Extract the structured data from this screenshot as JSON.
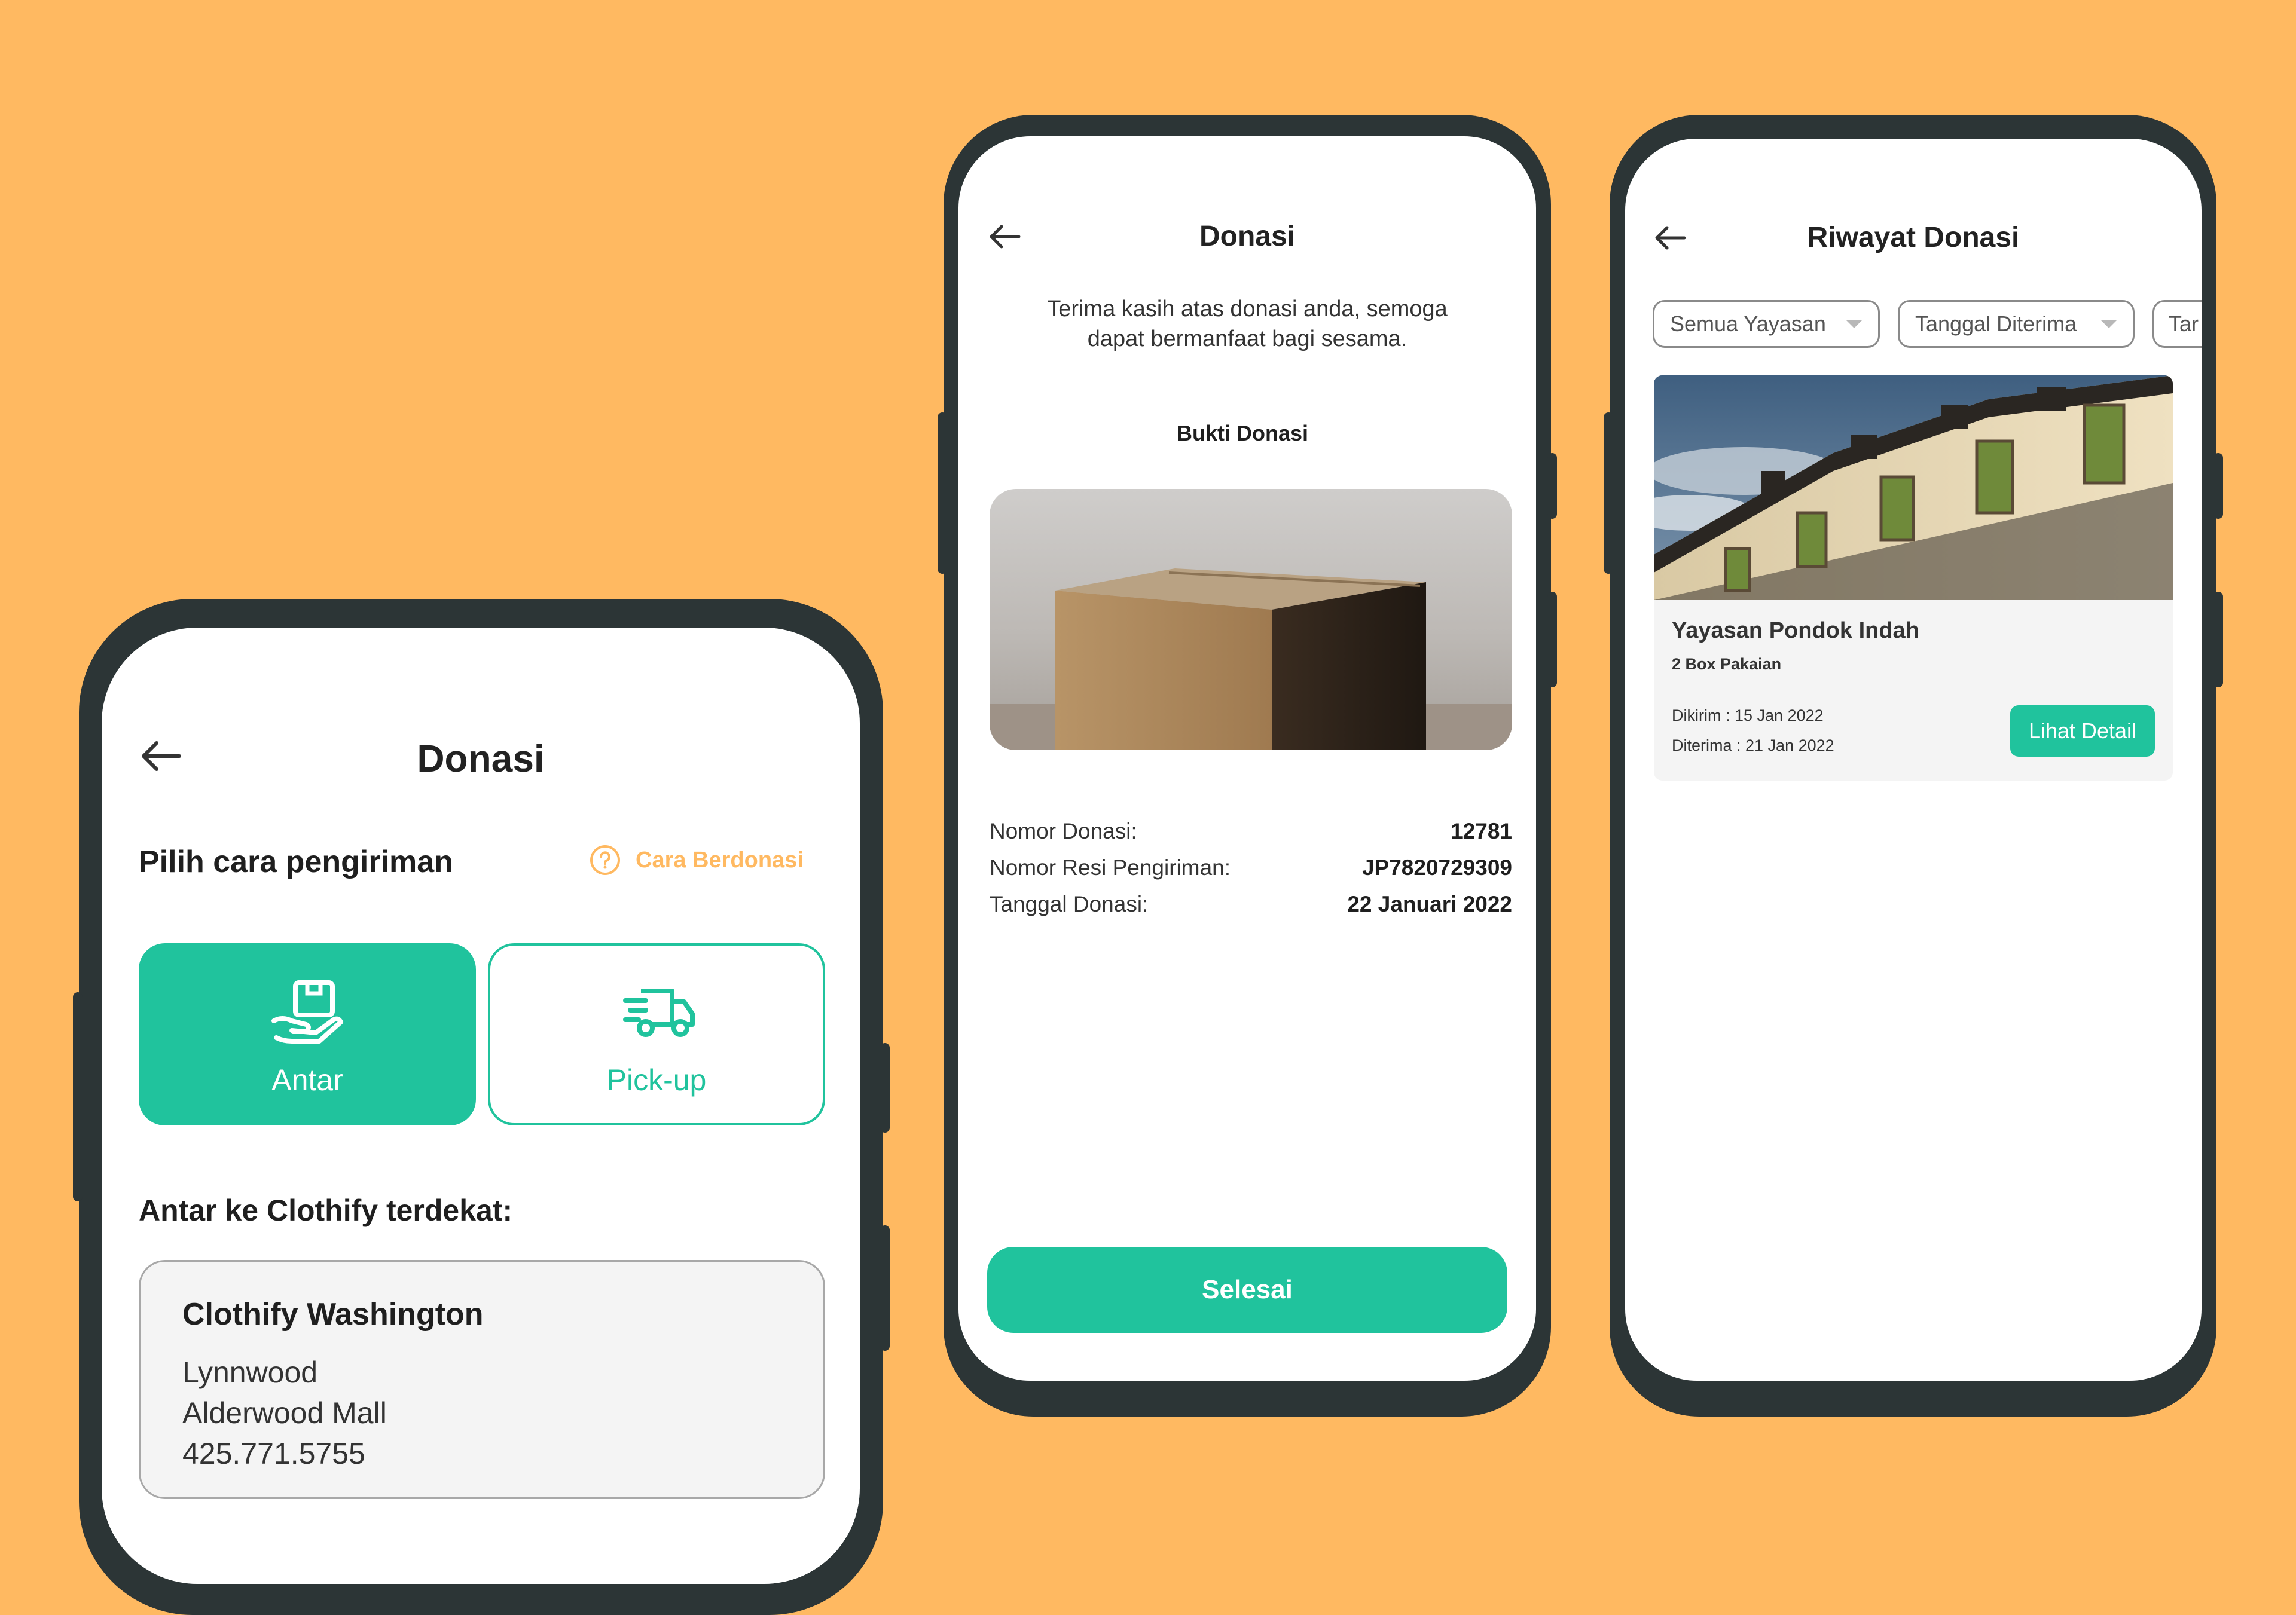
{
  "colors": {
    "background": "#FFB961",
    "accent": "#20C39D",
    "orange_link": "#FFB961",
    "phone_frame": "#2c3536"
  },
  "phone1": {
    "title": "Donasi",
    "section_title": "Pilih cara pengiriman",
    "help_link": "Cara Berdonasi",
    "options": [
      {
        "label": "Antar",
        "icon": "hand-box-icon",
        "selected": true
      },
      {
        "label": "Pick-up",
        "icon": "delivery-truck-icon",
        "selected": false
      }
    ],
    "nearest_title": "Antar ke Clothify terdekat:",
    "store": {
      "name": "Clothify Washington",
      "line1": "Lynnwood",
      "line2": "Alderwood Mall",
      "phone": "425.771.5755"
    }
  },
  "phone2": {
    "title": "Donasi",
    "thanks_line1": "Terima kasih atas donasi anda, semoga",
    "thanks_line2": "dapat bermanfaat bagi sesama.",
    "proof_title": "Bukti Donasi",
    "details": [
      {
        "label": "Nomor Donasi:",
        "value": "12781"
      },
      {
        "label": "Nomor Resi Pengiriman:",
        "value": "JP7820729309"
      },
      {
        "label": "Tanggal Donasi:",
        "value": "22 Januari 2022"
      }
    ],
    "finish_button": "Selesai"
  },
  "phone3": {
    "title": "Riwayat Donasi",
    "filters": [
      "Semua Yayasan",
      "Tanggal Diterima",
      "Tar"
    ],
    "card": {
      "name": "Yayasan Pondok Indah",
      "items": "2 Box Pakaian",
      "sent": "Dikirim : 15 Jan 2022",
      "received": "Diterima : 21 Jan 2022",
      "detail_button": "Lihat Detail"
    }
  }
}
